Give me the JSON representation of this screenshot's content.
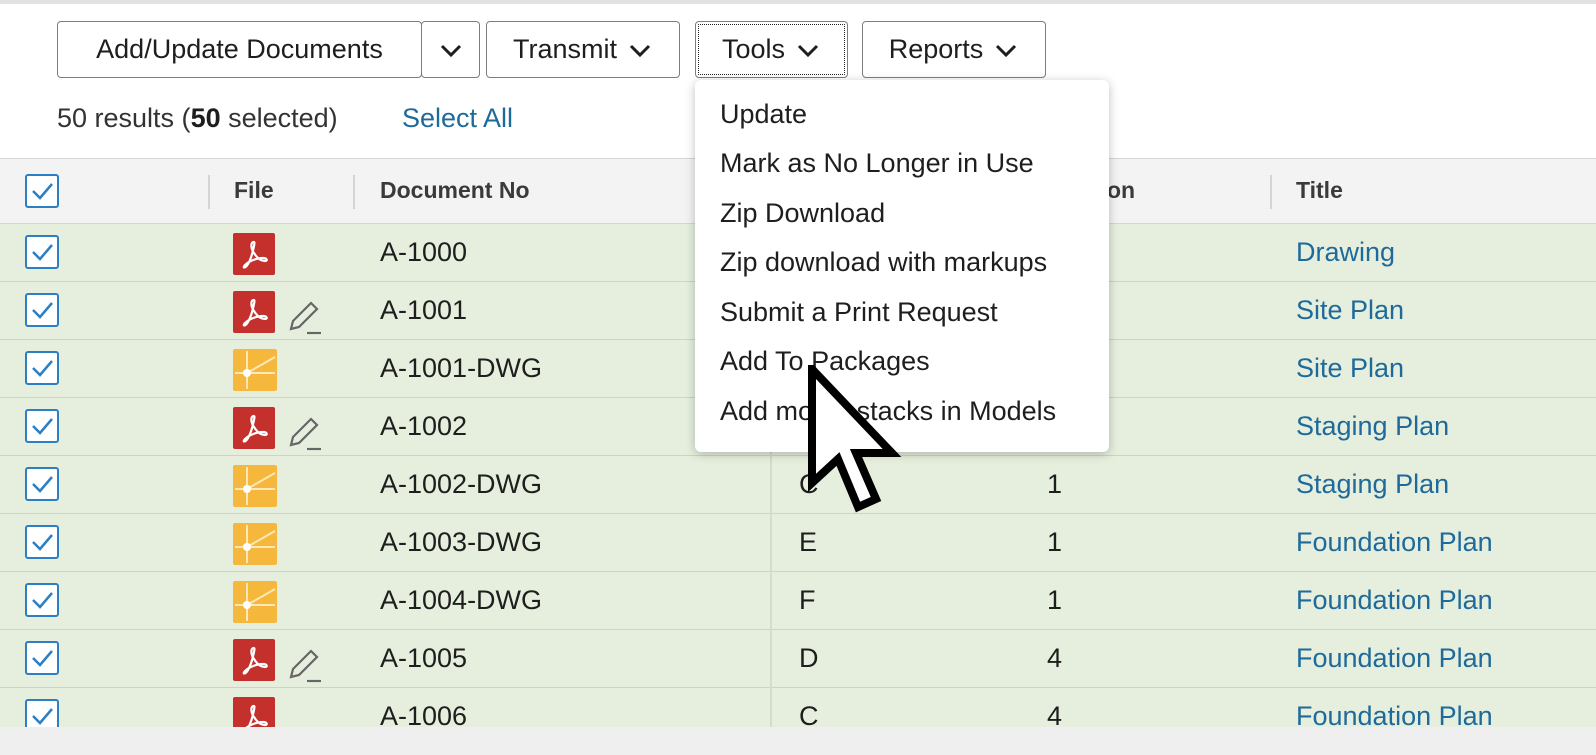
{
  "toolbar": {
    "add_update_label": "Add/Update Documents",
    "transmit_label": "Transmit",
    "tools_label": "Tools",
    "reports_label": "Reports"
  },
  "summary": {
    "count_prefix": "50 results (",
    "selected_count": "50",
    "selected_suffix": " selected)",
    "select_all_label": "Select All"
  },
  "table": {
    "columns": {
      "file": "File",
      "document_no": "Document No",
      "revision_partial": "on",
      "title": "Title"
    },
    "rows": [
      {
        "file_type": "pdf",
        "markup": false,
        "document_no": "A-1000",
        "rev_letter": "",
        "revision": "",
        "title": "Drawing"
      },
      {
        "file_type": "pdf",
        "markup": true,
        "document_no": "A-1001",
        "rev_letter": "",
        "revision": "",
        "title": "Site Plan"
      },
      {
        "file_type": "dwg",
        "markup": false,
        "document_no": "A-1001-DWG",
        "rev_letter": "",
        "revision": "",
        "title": "Site Plan"
      },
      {
        "file_type": "pdf",
        "markup": true,
        "document_no": "A-1002",
        "rev_letter": "",
        "revision": "",
        "title": "Staging Plan"
      },
      {
        "file_type": "dwg",
        "markup": false,
        "document_no": "A-1002-DWG",
        "rev_letter": "C",
        "revision": "1",
        "title": "Staging Plan"
      },
      {
        "file_type": "dwg",
        "markup": false,
        "document_no": "A-1003-DWG",
        "rev_letter": "E",
        "revision": "1",
        "title": "Foundation Plan"
      },
      {
        "file_type": "dwg",
        "markup": false,
        "document_no": "A-1004-DWG",
        "rev_letter": "F",
        "revision": "1",
        "title": "Foundation Plan"
      },
      {
        "file_type": "pdf",
        "markup": true,
        "document_no": "A-1005",
        "rev_letter": "D",
        "revision": "4",
        "title": "Foundation Plan"
      },
      {
        "file_type": "pdf",
        "markup": false,
        "document_no": "A-1006",
        "rev_letter": "C",
        "revision": "4",
        "title": "Foundation Plan"
      }
    ]
  },
  "tools_menu": {
    "items": [
      "Update",
      "Mark as No Longer in Use",
      "Zip Download",
      "Zip download with markups",
      "Submit a Print Request",
      "Add To Packages",
      "Add model stacks in Models"
    ]
  },
  "colors": {
    "row_selected_bg": "#e6efdd",
    "link": "#1e6a9a",
    "checkbox": "#2b7fc2",
    "pdf_icon": "#c4302b",
    "dwg_icon": "#f6b83c"
  },
  "icons": {
    "chevron": "chevron-down-icon",
    "checkbox": "checkbox-checked-icon",
    "pdf": "pdf-file-icon",
    "dwg": "dwg-file-icon",
    "markup": "pencil-icon",
    "cursor": "mouse-pointer-icon"
  }
}
